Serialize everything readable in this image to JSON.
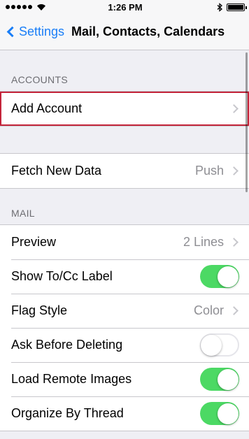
{
  "status": {
    "time": "1:26 PM"
  },
  "nav": {
    "back_label": "Settings",
    "title": "Mail, Contacts, Calendars"
  },
  "accounts": {
    "header": "ACCOUNTS",
    "add_account": "Add Account"
  },
  "fetch": {
    "label": "Fetch New Data",
    "value": "Push"
  },
  "mail": {
    "header": "MAIL",
    "rows": [
      {
        "label": "Preview",
        "value": "2 Lines"
      },
      {
        "label": "Show To/Cc Label",
        "toggle": true
      },
      {
        "label": "Flag Style",
        "value": "Color"
      },
      {
        "label": "Ask Before Deleting",
        "toggle": false
      },
      {
        "label": "Load Remote Images",
        "toggle": true
      },
      {
        "label": "Organize By Thread",
        "toggle": true
      }
    ]
  },
  "colors": {
    "accent": "#1a7ef7",
    "toggle_on": "#4cd964",
    "highlight": "#c4243a"
  },
  "icons": [
    "signal-dots-icon",
    "wifi-icon",
    "bluetooth-icon",
    "battery-icon",
    "back-chevron-icon",
    "chevron-right-icon"
  ]
}
